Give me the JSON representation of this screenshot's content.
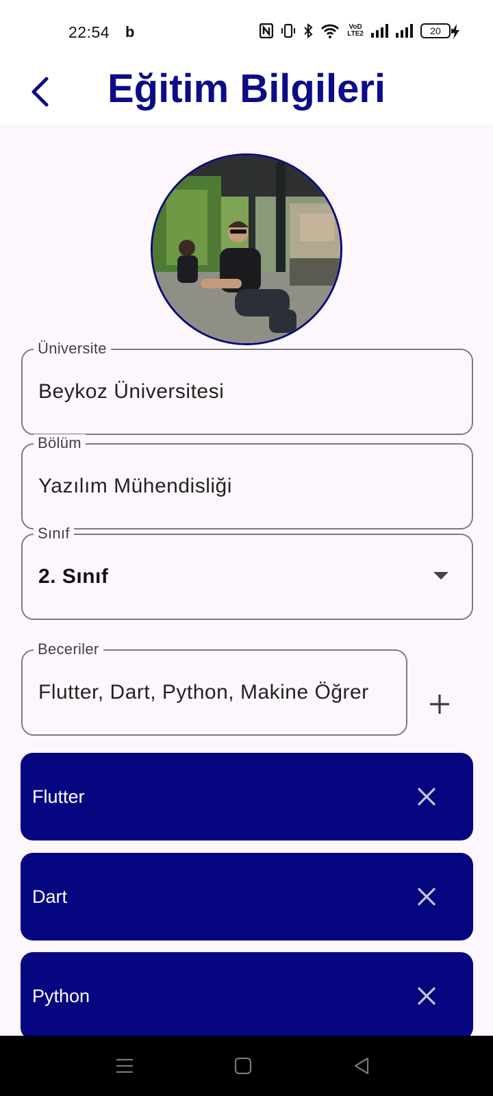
{
  "status_bar": {
    "time": "22:54",
    "bing_glyph": "b",
    "volte_label_top": "VoD",
    "volte_label_bottom": "LTE2",
    "battery_level": "20"
  },
  "header": {
    "title": "Eğitim Bilgileri",
    "back_icon": "back-arrow-icon"
  },
  "profile": {
    "avatar_icon": "profile-photo"
  },
  "form": {
    "university": {
      "label": "Üniversite",
      "value": "Beykoz Üniversitesi"
    },
    "department": {
      "label": "Bölüm",
      "value": "Yazılım Mühendisliği"
    },
    "grade": {
      "label": "Sınıf",
      "value": "2. Sınıf"
    },
    "skills": {
      "label": "Beceriler",
      "value": "Flutter, Dart, Python, Makine Öğrer"
    }
  },
  "skill_chips": [
    {
      "label": "Flutter"
    },
    {
      "label": "Dart"
    },
    {
      "label": "Python"
    }
  ],
  "colors": {
    "primary": "#060681",
    "title": "#0c0c88",
    "background": "#fdf7fd"
  }
}
